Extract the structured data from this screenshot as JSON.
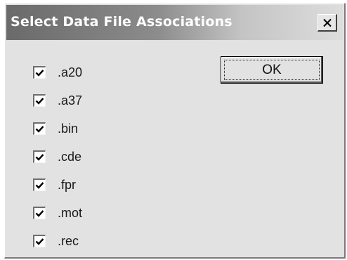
{
  "window": {
    "title": "Select Data File Associations",
    "close_label": "X"
  },
  "ok_button": {
    "label": "OK"
  },
  "associations": [
    {
      "label": ".a20",
      "checked": true
    },
    {
      "label": ".a37",
      "checked": true
    },
    {
      "label": ".bin",
      "checked": true
    },
    {
      "label": ".cde",
      "checked": true
    },
    {
      "label": ".fpr",
      "checked": true
    },
    {
      "label": ".mot",
      "checked": true
    },
    {
      "label": ".rec",
      "checked": true
    }
  ],
  "colors": {
    "title_gradient_start": "#6a6a6a",
    "title_gradient_end": "#dddddd",
    "window_face": "#e2e2e2",
    "title_text": "#ffffff"
  },
  "icons": {
    "close": "close-icon",
    "check": "checkmark-icon"
  }
}
